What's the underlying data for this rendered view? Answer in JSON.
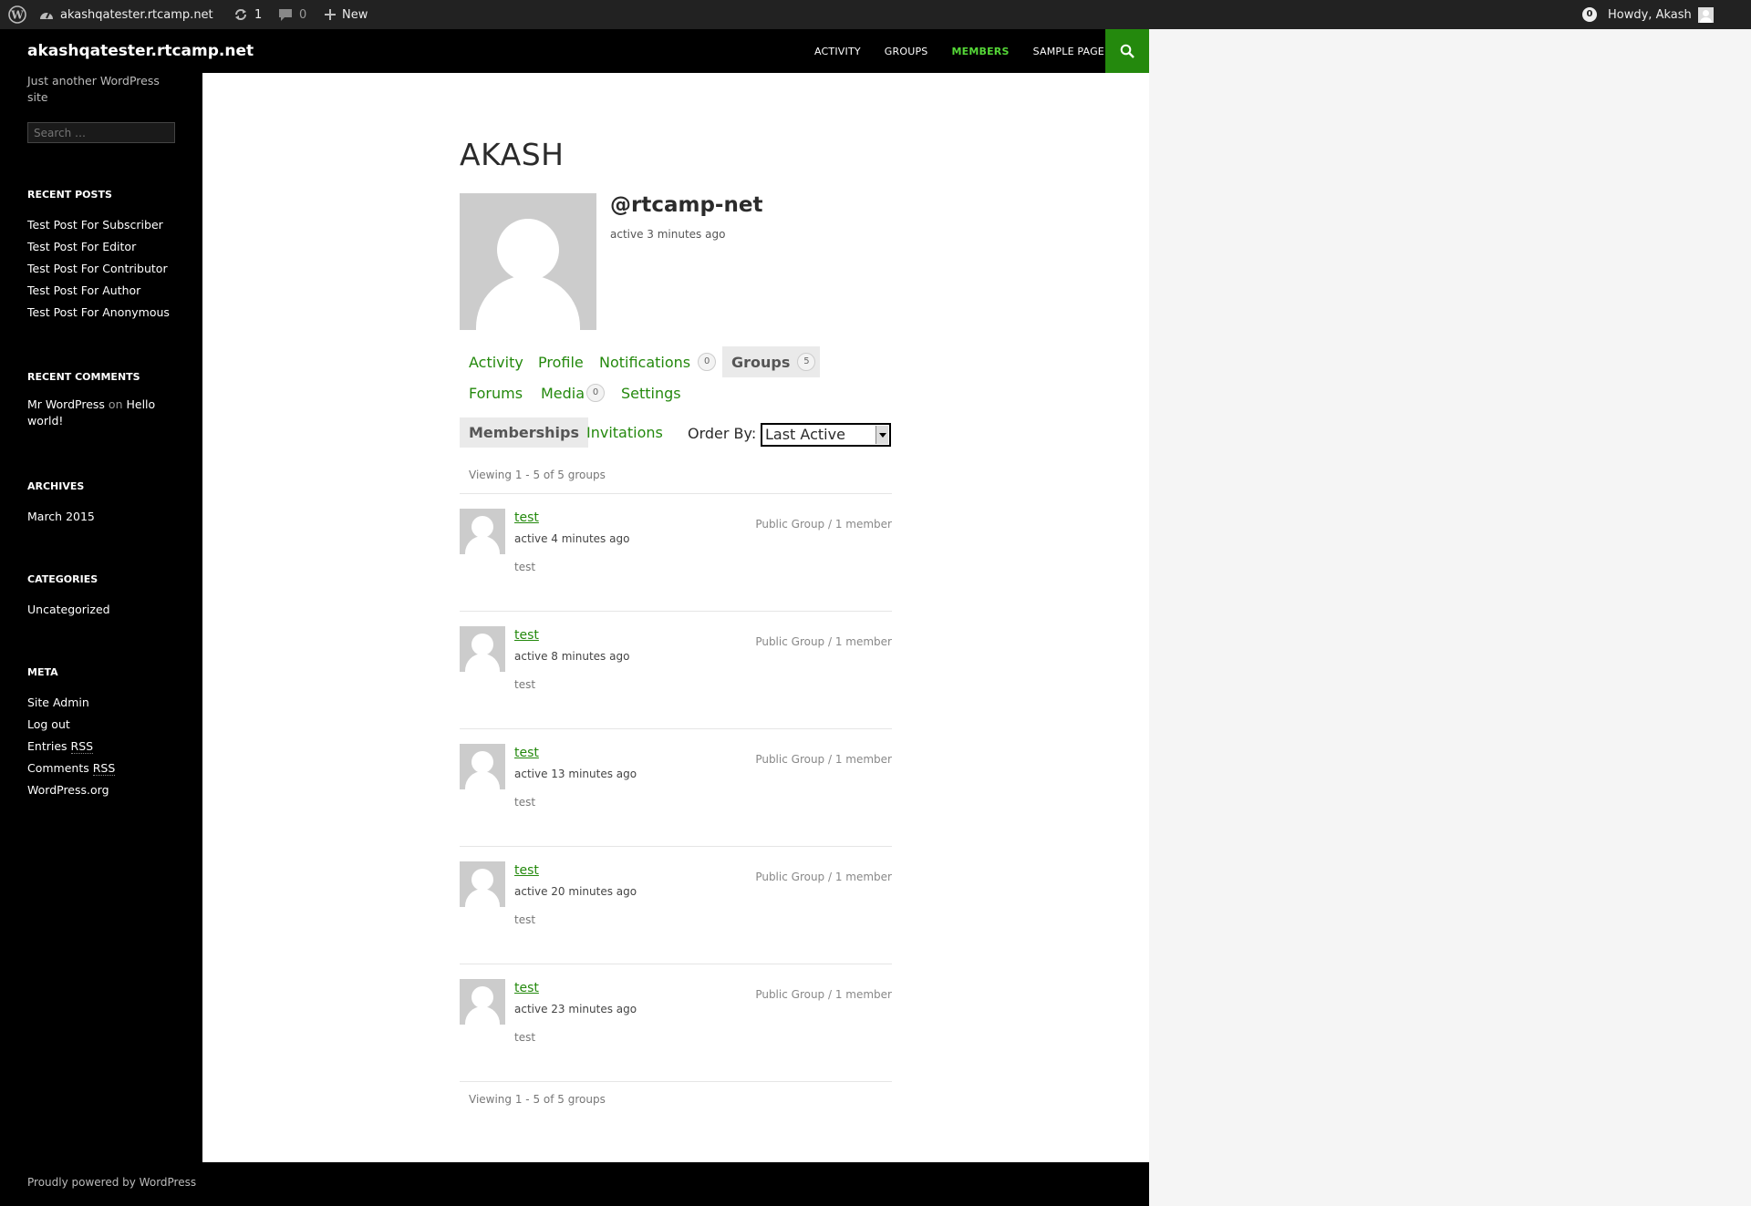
{
  "admin_bar": {
    "site_name": "akashqatester.rtcamp.net",
    "updates_count": "1",
    "comments_count": "0",
    "new_label": "New",
    "notifications_count": "0",
    "howdy": "Howdy, Akash"
  },
  "site": {
    "title": "akashqatester.rtcamp.net",
    "tagline": "Just another WordPress site",
    "search_placeholder": "Search …",
    "footer": "Proudly powered by WordPress"
  },
  "nav": {
    "items": [
      "ACTIVITY",
      "GROUPS",
      "MEMBERS",
      "SAMPLE PAGE"
    ],
    "current": "MEMBERS"
  },
  "widgets": {
    "recent_posts": {
      "title": "RECENT POSTS",
      "items": [
        "Test Post For Subscriber",
        "Test Post For Editor",
        "Test Post For Contributor",
        "Test Post For Author",
        "Test Post For Anonymous"
      ]
    },
    "recent_comments": {
      "title": "RECENT COMMENTS",
      "author": "Mr WordPress",
      "on": "on",
      "post": "Hello world!"
    },
    "archives": {
      "title": "ARCHIVES",
      "items": [
        "March 2015"
      ]
    },
    "categories": {
      "title": "CATEGORIES",
      "items": [
        "Uncategorized"
      ]
    },
    "meta": {
      "title": "META",
      "site_admin": "Site Admin",
      "log_out": "Log out",
      "entries": "Entries",
      "comments": "Comments",
      "rss": "RSS",
      "wordpress_org": "WordPress.org"
    }
  },
  "profile": {
    "name": "AKASH",
    "handle": "@rtcamp-net",
    "last_active": "active 3 minutes ago",
    "tabs": {
      "activity": "Activity",
      "profile": "Profile",
      "notifications": "Notifications",
      "notifications_count": "0",
      "groups": "Groups",
      "groups_count": "5",
      "forums": "Forums",
      "media": "Media",
      "media_count": "0",
      "settings": "Settings"
    },
    "subtabs": {
      "memberships": "Memberships",
      "invitations": "Invitations"
    },
    "order_by_label": "Order By:",
    "order_by_value": "Last Active",
    "viewing_top": "Viewing 1 - 5 of 5 groups",
    "viewing_bottom": "Viewing 1 - 5 of 5 groups"
  },
  "groups": [
    {
      "name": "test",
      "active": "active 4 minutes ago",
      "description": "test",
      "meta": "Public Group / 1 member"
    },
    {
      "name": "test",
      "active": "active 8 minutes ago",
      "description": "test",
      "meta": "Public Group / 1 member"
    },
    {
      "name": "test",
      "active": "active 13 minutes ago",
      "description": "test",
      "meta": "Public Group / 1 member"
    },
    {
      "name": "test",
      "active": "active 20 minutes ago",
      "description": "test",
      "meta": "Public Group / 1 member"
    },
    {
      "name": "test",
      "active": "active 23 minutes ago",
      "description": "test",
      "meta": "Public Group / 1 member"
    }
  ],
  "colors": {
    "accent": "#24890d",
    "accent_light": "#55d737",
    "admin_bar": "#222222",
    "sidebar": "#000000"
  }
}
